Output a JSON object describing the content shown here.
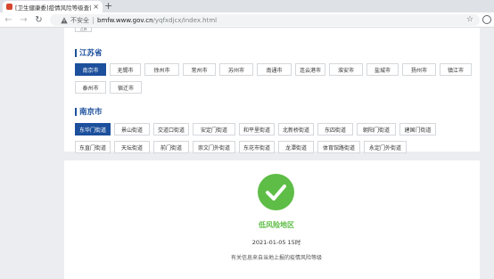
{
  "browser": {
    "tab_title": "[卫生健康委]疫情风险等级查询",
    "tab_close": "×",
    "new_tab": "+",
    "not_secure": "不安全",
    "url_host": "bmfw.www.gov.cn",
    "url_path": "/yqfxdjcx/index.html"
  },
  "top_partial_button": "江苏",
  "province": {
    "title": "江苏省",
    "cities": [
      "南京市",
      "无锡市",
      "徐州市",
      "常州市",
      "苏州市",
      "南通市",
      "连云港市",
      "淮安市",
      "盐城市",
      "扬州市",
      "镇江市",
      "泰州市",
      "宿迁市"
    ],
    "selected": "南京市"
  },
  "city": {
    "title": "南京市",
    "streets": [
      "东华门街道",
      "景山街道",
      "交道口街道",
      "安定门街道",
      "和平里街道",
      "北新桥街道",
      "东四街道",
      "朝阳门街道",
      "建国门街道",
      "东直门街道",
      "天坛街道",
      "前门街道",
      "崇文门外街道",
      "东花市街道",
      "龙潭街道",
      "体育馆路街道",
      "永定门外街道"
    ],
    "selected": "东华门街道"
  },
  "result": {
    "risk_level": "低风险地区",
    "timestamp": "2021-01-05 15时",
    "note": "有关信息来自当地上报的疫情风险等级",
    "color": "#5ebd46"
  },
  "colors": {
    "accent": "#1c4f9c",
    "low_risk": "#5ebd46"
  }
}
